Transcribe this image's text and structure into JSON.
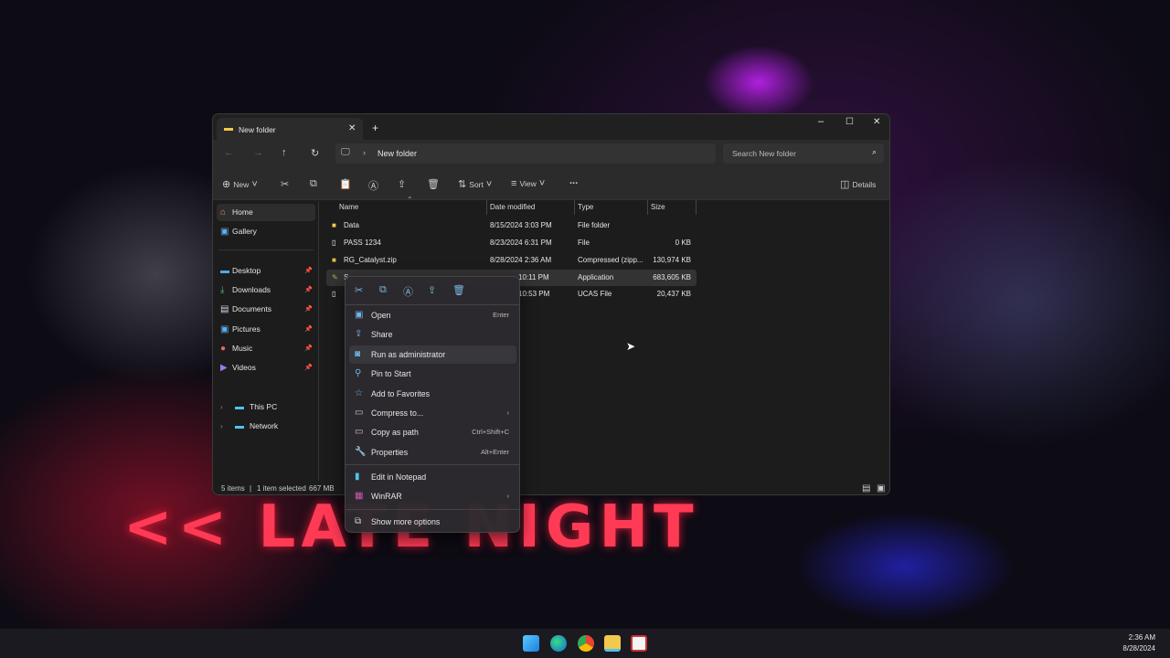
{
  "window": {
    "tab_title": "New folder",
    "path": "New folder",
    "search_placeholder": "Search New folder"
  },
  "toolbar": {
    "new": "New",
    "sort": "Sort",
    "view": "View",
    "more": "...",
    "details": "Details"
  },
  "sidebar": {
    "items": [
      {
        "label": "Home"
      },
      {
        "label": "Gallery"
      },
      {
        "label": "Desktop"
      },
      {
        "label": "Downloads"
      },
      {
        "label": "Documents"
      },
      {
        "label": "Pictures"
      },
      {
        "label": "Music"
      },
      {
        "label": "Videos"
      },
      {
        "label": "This PC"
      },
      {
        "label": "Network"
      }
    ]
  },
  "columns": {
    "name": "Name",
    "date": "Date modified",
    "type": "Type",
    "size": "Size"
  },
  "files": [
    {
      "name": "Data",
      "date": "8/15/2024 3:03 PM",
      "type": "File folder",
      "size": ""
    },
    {
      "name": "PASS 1234",
      "date": "8/23/2024 6:31 PM",
      "type": "File",
      "size": "0 KB"
    },
    {
      "name": "RG_Catalyst.zip",
      "date": "8/28/2024 2:36 AM",
      "type": "Compressed (zipp...",
      "size": "130,974 KB"
    },
    {
      "name": "S",
      "date": "10:11 PM",
      "type": "Application",
      "size": "683,605 KB"
    },
    {
      "name": "",
      "date": "10:53 PM",
      "type": "UCAS File",
      "size": "20,437 KB"
    }
  ],
  "status": {
    "count": "5 items",
    "selected": "1 item selected",
    "size": "667 MB"
  },
  "context_menu": {
    "items": [
      {
        "label": "Open",
        "shortcut": "Enter"
      },
      {
        "label": "Share",
        "shortcut": ""
      },
      {
        "label": "Run as administrator",
        "shortcut": ""
      },
      {
        "label": "Pin to Start",
        "shortcut": ""
      },
      {
        "label": "Add to Favorites",
        "shortcut": ""
      },
      {
        "label": "Compress to...",
        "shortcut": ""
      },
      {
        "label": "Copy as path",
        "shortcut": "Ctrl+Shift+C"
      },
      {
        "label": "Properties",
        "shortcut": "Alt+Enter"
      },
      {
        "label": "Edit in Notepad",
        "shortcut": ""
      },
      {
        "label": "WinRAR",
        "shortcut": ""
      },
      {
        "label": "Show more options",
        "shortcut": ""
      }
    ]
  },
  "background": {
    "neon_text": "<< LATE NIGHT"
  },
  "clock": {
    "time": "2:36 AM",
    "date": "8/28/2024"
  }
}
